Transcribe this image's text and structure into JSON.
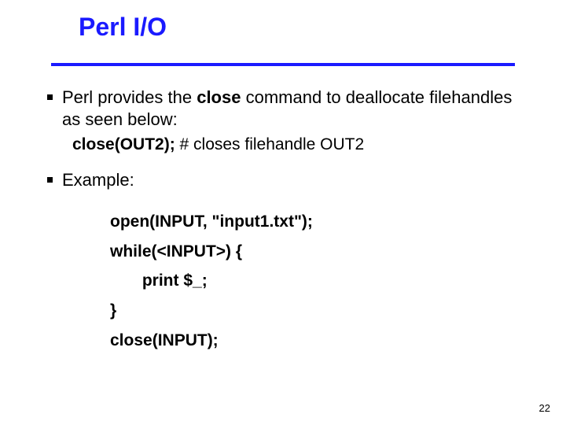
{
  "title": "Perl I/O",
  "bullets": {
    "b1_pre": "Perl provides the ",
    "b1_bold": "close",
    "b1_post": " command to deallocate filehandles as seen below:",
    "b1_sub_bold": "close(OUT2);",
    "b1_sub_rest": " # closes filehandle OUT2",
    "b2": "Example:"
  },
  "code": {
    "l1": "open(INPUT, \"input1.txt\");",
    "l2": "while(<INPUT>) {",
    "l3": "       print $_;",
    "l4": "}",
    "l5": "close(INPUT);"
  },
  "page_number": "22"
}
